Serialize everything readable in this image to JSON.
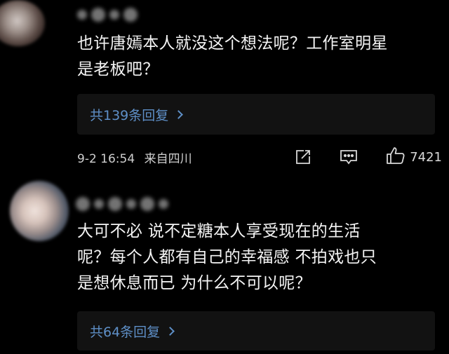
{
  "comments": [
    {
      "text_line1": "也许唐嫣本人就没这个想法呢？工作室明星",
      "text_line2": "是老板吧？",
      "replies_label": "共139条回复",
      "time": "9-2 16:54",
      "location": "来自四川",
      "like_count": "7421"
    },
    {
      "text_line1": "大可不必  说不定糖本人享受现在的生活",
      "text_line2": "呢？每个人都有自己的幸福感  不拍戏也只",
      "text_line3": "是想休息而已  为什么不可以呢？",
      "replies_label": "共64条回复"
    }
  ],
  "icons": {
    "share": "share-icon",
    "comment": "comment-icon",
    "like": "thumbs-up-icon",
    "reply_chevron": "chevron-right-icon"
  },
  "colors": {
    "background": "#000000",
    "link": "#5e8fc7",
    "text": "#f4f4f4",
    "reply_box": "#121212"
  }
}
